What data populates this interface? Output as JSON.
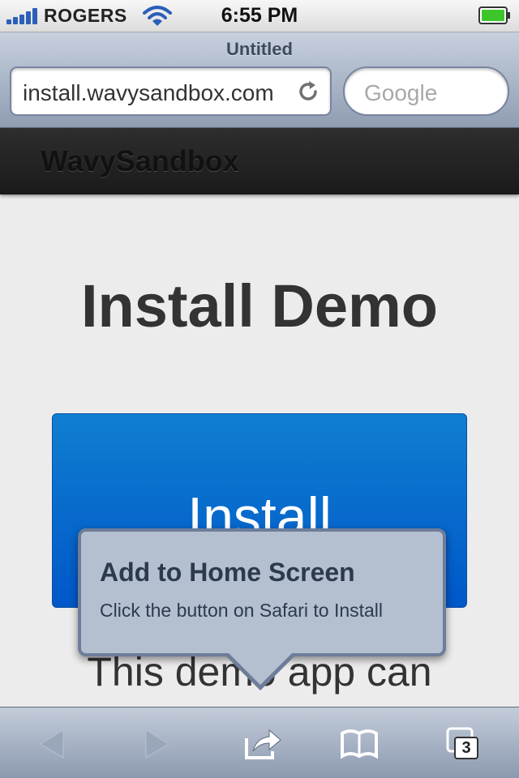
{
  "status_bar": {
    "carrier": "ROGERS",
    "time": "6:55 PM"
  },
  "browser": {
    "page_title": "Untitled",
    "url": "install.wavysandbox.com",
    "search_placeholder": "Google"
  },
  "site": {
    "brand": "WavySandbox",
    "heading": "Install Demo",
    "install_button_label": "Install",
    "body_text": "This demo app can"
  },
  "popover": {
    "title": "Add to Home Screen",
    "message": "Click the button on Safari to Install"
  },
  "toolbar": {
    "tab_count": "3",
    "icons": [
      "back-icon",
      "forward-icon",
      "share-icon",
      "bookmarks-icon",
      "tabs-icon"
    ]
  },
  "colors": {
    "install_button": "#0068cc",
    "popover_bg": "#b4c0d0",
    "nav_bar": "#242424"
  }
}
